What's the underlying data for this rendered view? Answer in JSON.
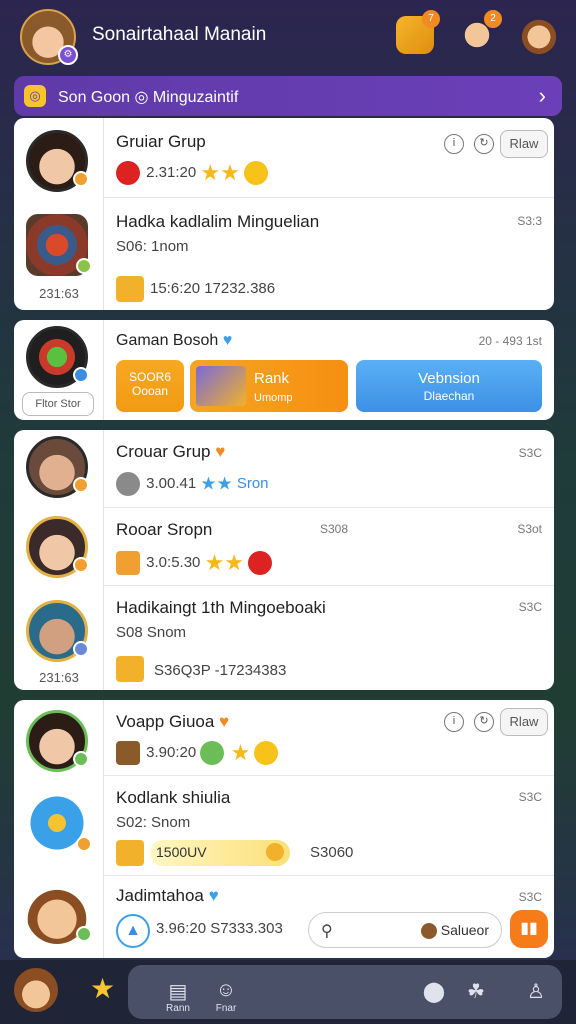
{
  "header": {
    "title": "Sonairtahaal Manain",
    "avatar_badge": "⚙",
    "notif1": "7",
    "notif2": "2"
  },
  "banner": {
    "text": "Son Goon ◎ Minguzaintif",
    "chevron": "›"
  },
  "card1": {
    "caption": "231:63",
    "rows": [
      {
        "name": "Gruiar Grup",
        "sub": "2.31:20",
        "pill": "Rlaw"
      },
      {
        "name": "Hadka kadlalim Minguelian",
        "sub": "S06: 1nom",
        "meta": "S3:3",
        "foot": "15:6:20  17232.386"
      }
    ]
  },
  "card2": {
    "caption": "Fltor Stor",
    "title": "Gaman Bosoh",
    "meta": "20 - 493 1st",
    "tile1_top": "SOOR6",
    "tile1_bot": "Oooan",
    "tile2_top": "Rank",
    "tile2_bot": "Umomp",
    "tile3_top": "Vebnsion",
    "tile3_bot": "Dlaechan"
  },
  "card3": {
    "caption": "231:63",
    "rows": [
      {
        "name": "Crouar Grup",
        "sub": "3.00.41",
        "tag": "Sron",
        "meta": "S3C"
      },
      {
        "name": "Rooar Sropn",
        "sub": "3.0:5.30",
        "meta": "S3ot",
        "meta2": "S308"
      },
      {
        "name": "Hadikaingt 1th Mingoeboaki",
        "sub": "S08 Snom",
        "meta": "S3C",
        "foot": "S36Q3P  -17234383"
      }
    ]
  },
  "card4": {
    "rows": [
      {
        "name": "Voapp Giuoa",
        "sub": "3.90:20",
        "pill": "Rlaw"
      },
      {
        "name": "Kodlank shiulia",
        "sub": "S02: Snom",
        "meta": "S3C",
        "foot1": "1500UV",
        "foot2": "S3060"
      },
      {
        "name": "Jadimtahoa",
        "sub": "3.96:20  S7333.303",
        "meta": "S3C"
      }
    ],
    "search_label": "Salueor"
  },
  "bottom": {
    "lbl1": "Rann",
    "lbl2": "Fnar"
  }
}
